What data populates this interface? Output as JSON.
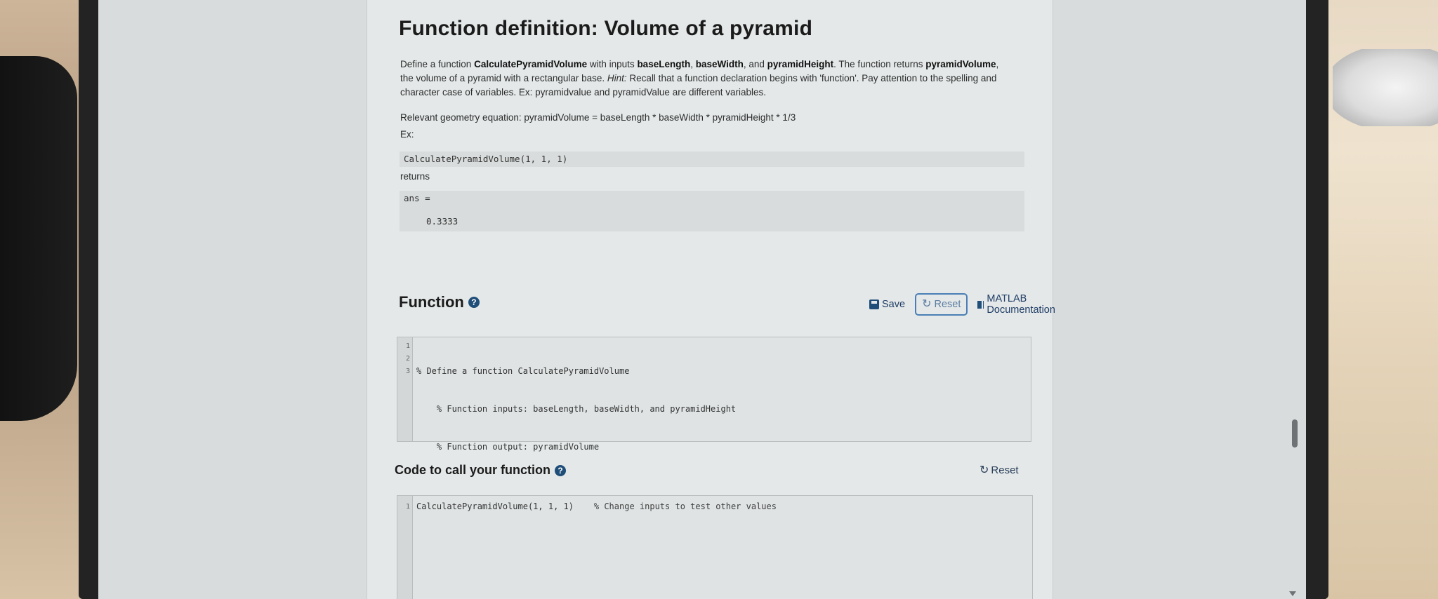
{
  "problem": {
    "title": "Function definition: Volume of a pyramid",
    "desc_text": {
      "p1": "Define a function ",
      "fname": "CalculatePyramidVolume",
      "p2": " with inputs ",
      "in1": "baseLength",
      "sep1": ", ",
      "in2": "baseWidth",
      "sep2": ", and ",
      "in3": "pyramidHeight",
      "p3": ". The function returns ",
      "out": "pyramidVolume",
      "p4": ", the volume of a pyramid with a rectangular base. ",
      "hint_label": "Hint:",
      "p5": " Recall that a function declaration begins with 'function'. Pay attention to the spelling and character case of variables. Ex: pyramidvalue and pyramidValue are different variables."
    },
    "equation": "Relevant geometry equation: pyramidVolume = baseLength * baseWidth * pyramidHeight * 1/3",
    "example_label": "Ex:",
    "example_call": "CalculatePyramidVolume(1, 1, 1)",
    "returns_label": "returns",
    "output_line1": "ans =",
    "output_line2": "0.3333"
  },
  "function_section": {
    "heading": "Function",
    "save_label": "Save",
    "reset_label": "Reset",
    "docs_label": "MATLAB Documentation",
    "line_numbers": [
      "1",
      "2",
      "3"
    ],
    "code_lines": [
      "% Define a function CalculatePyramidVolume",
      "    % Function inputs: baseLength, baseWidth, and pyramidHeight",
      "    % Function output: pyramidVolume"
    ]
  },
  "call_section": {
    "heading": "Code to call your function",
    "reset_label": "Reset",
    "line_numbers": [
      "1"
    ],
    "code": "CalculatePyramidVolume(1, 1, 1)",
    "comment": "% Change inputs to test other values"
  },
  "icons": {
    "help": "question-circle-icon",
    "save": "floppy-disk-icon",
    "reset": "refresh-icon",
    "docs": "book-icon"
  },
  "colors": {
    "accent": "#1f4e79",
    "reset_border": "#4a7fb5",
    "page_bg": "#e4e8e8"
  }
}
